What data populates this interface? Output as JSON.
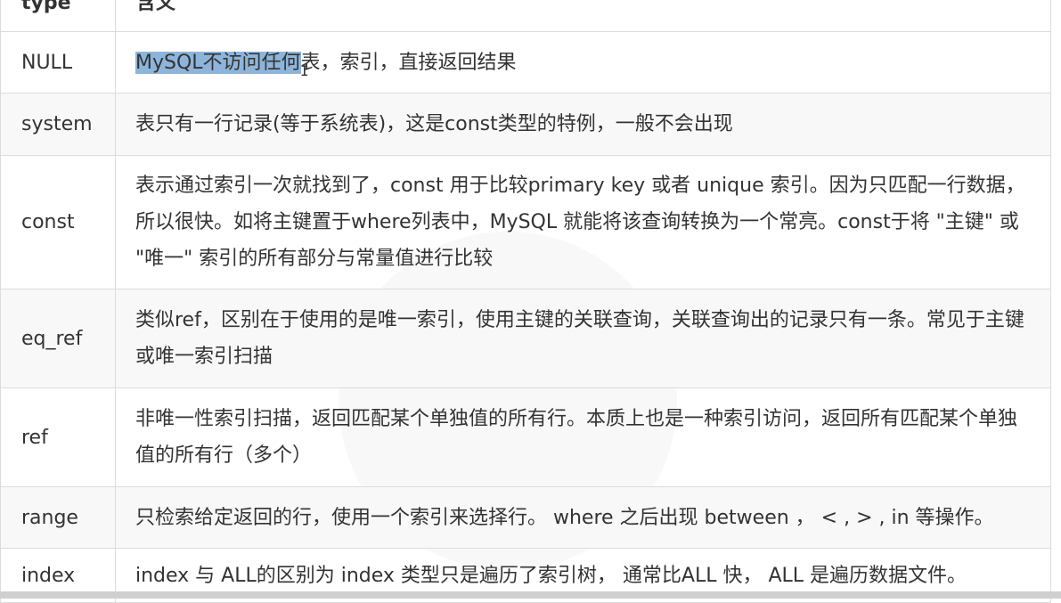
{
  "header": {
    "type": "type",
    "meaning": "含义"
  },
  "rows": [
    {
      "type": "NULL",
      "desc_selected": "MySQL不访问任何",
      "desc": "表，索引，直接返回结果"
    },
    {
      "type": "system",
      "desc": "表只有一行记录(等于系统表)，这是const类型的特例，一般不会出现"
    },
    {
      "type": "const",
      "desc": "表示通过索引一次就找到了，const 用于比较primary key 或者 unique 索引。因为只匹配一行数据，所以很快。如将主键置于where列表中，MySQL 就能将该查询转换为一个常亮。const于将 \"主键\" 或 \"唯一\" 索引的所有部分与常量值进行比较"
    },
    {
      "type": "eq_ref",
      "desc": "类似ref，区别在于使用的是唯一索引，使用主键的关联查询，关联查询出的记录只有一条。常见于主键或唯一索引扫描"
    },
    {
      "type": "ref",
      "desc": "非唯一性索引扫描，返回匹配某个单独值的所有行。本质上也是一种索引访问，返回所有匹配某个单独值的所有行（多个）"
    },
    {
      "type": "range",
      "desc": "只检索给定返回的行，使用一个索引来选择行。 where 之后出现 between ， < , > , in 等操作。"
    },
    {
      "type": "index",
      "desc": "index 与 ALL的区别为 index 类型只是遍历了索引树， 通常比ALL 快， ALL 是遍历数据文件。"
    }
  ]
}
